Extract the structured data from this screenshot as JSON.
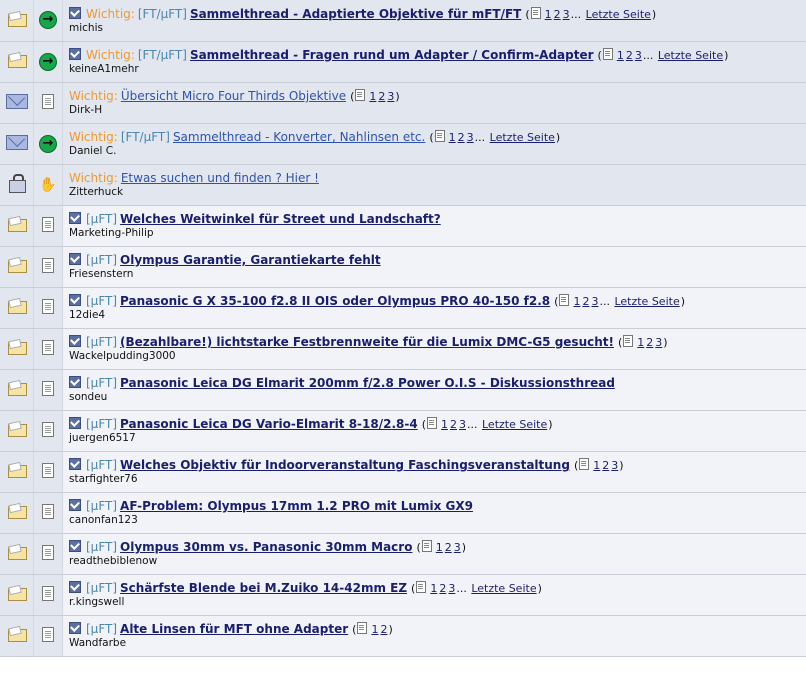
{
  "labels": {
    "wichtig": "Wichtig:",
    "last_page": "Letzte Seite",
    "ellipsis": "..."
  },
  "colors": {
    "wichtig": "#f0992e",
    "prefix": "#4b86ae",
    "link": "#1a1e6e",
    "row_sticky": "#e2e6ef",
    "row_normal": "#f1f3f8"
  },
  "threads": [
    {
      "status_icon": "folder-hot-icon",
      "topic_icon": "green-arrow-icon",
      "checked": true,
      "wichtig": true,
      "prefix": "[FT/µFT]",
      "title": "Sammelthread - Adaptierte Objektive für mFT/FT",
      "bold": true,
      "pages": [
        "1",
        "2",
        "3"
      ],
      "last_page": true,
      "author": "michis"
    },
    {
      "status_icon": "folder-hot-icon",
      "topic_icon": "green-arrow-icon",
      "checked": true,
      "wichtig": true,
      "prefix": "[FT/µFT]",
      "title": "Sammelthread - Fragen rund um Adapter / Confirm-Adapter",
      "bold": true,
      "pages": [
        "1",
        "2",
        "3"
      ],
      "last_page": true,
      "author": "keineA1mehr"
    },
    {
      "status_icon": "mail-icon",
      "topic_icon": "document-icon",
      "checked": false,
      "wichtig": true,
      "prefix": "",
      "title": "Übersicht Micro Four Thirds Objektive",
      "bold": false,
      "pages": [
        "1",
        "2",
        "3"
      ],
      "last_page": false,
      "author": "Dirk-H"
    },
    {
      "status_icon": "mail-icon",
      "topic_icon": "green-arrow-icon",
      "checked": false,
      "wichtig": true,
      "prefix": "[FT/µFT]",
      "title": "Sammelthread - Konverter, Nahlinsen etc.",
      "bold": false,
      "pages": [
        "1",
        "2",
        "3"
      ],
      "last_page": true,
      "author": "Daniel C."
    },
    {
      "status_icon": "lock-icon",
      "topic_icon": "thumbs-up-icon",
      "checked": false,
      "wichtig": true,
      "prefix": "",
      "title": "Etwas suchen und finden ? Hier !",
      "bold": false,
      "pages": [],
      "last_page": false,
      "author": "Zitterhuck"
    },
    {
      "status_icon": "folder-hot-icon",
      "topic_icon": "document-icon",
      "checked": true,
      "wichtig": false,
      "prefix": "[µFT]",
      "title": "Welches Weitwinkel für Street und Landschaft?",
      "bold": true,
      "pages": [],
      "last_page": false,
      "author": "Marketing-Philip"
    },
    {
      "status_icon": "folder-hot-icon",
      "topic_icon": "document-icon",
      "checked": true,
      "wichtig": false,
      "prefix": "[µFT]",
      "title": "Olympus Garantie, Garantiekarte fehlt",
      "bold": true,
      "pages": [],
      "last_page": false,
      "author": "Friesenstern"
    },
    {
      "status_icon": "folder-hot-icon",
      "topic_icon": "document-icon",
      "checked": true,
      "wichtig": false,
      "prefix": "[µFT]",
      "title": "Panasonic G X 35-100 f2.8 II OIS oder Olympus PRO 40-150 f2.8",
      "bold": true,
      "pages": [
        "1",
        "2",
        "3"
      ],
      "last_page": true,
      "author": "12die4"
    },
    {
      "status_icon": "folder-hot-icon",
      "topic_icon": "document-icon",
      "checked": true,
      "wichtig": false,
      "prefix": "[µFT]",
      "title": "(Bezahlbare!) lichtstarke Festbrennweite für die Lumix DMC-G5 gesucht!",
      "bold": true,
      "pages": [
        "1",
        "2",
        "3"
      ],
      "last_page": false,
      "author": "Wackelpudding3000"
    },
    {
      "status_icon": "folder-hot-icon",
      "topic_icon": "document-icon",
      "checked": true,
      "wichtig": false,
      "prefix": "[µFT]",
      "title": "Panasonic Leica DG Elmarit 200mm f/2.8 Power O.I.S - Diskussionsthread",
      "bold": true,
      "pages": [],
      "last_page": false,
      "author": "sondeu"
    },
    {
      "status_icon": "folder-hot-icon",
      "topic_icon": "document-icon",
      "checked": true,
      "wichtig": false,
      "prefix": "[µFT]",
      "title": "Panasonic Leica DG Vario-Elmarit 8-18/2.8-4",
      "bold": true,
      "pages": [
        "1",
        "2",
        "3"
      ],
      "last_page": true,
      "author": "juergen6517"
    },
    {
      "status_icon": "folder-hot-icon",
      "topic_icon": "document-icon",
      "checked": true,
      "wichtig": false,
      "prefix": "[µFT]",
      "title": "Welches Objektiv für Indoorveranstaltung Faschingsveranstaltung",
      "bold": true,
      "pages": [
        "1",
        "2",
        "3"
      ],
      "last_page": false,
      "author": "starfighter76"
    },
    {
      "status_icon": "folder-hot-icon",
      "topic_icon": "document-icon",
      "checked": true,
      "wichtig": false,
      "prefix": "[µFT]",
      "title": "AF-Problem: Olympus 17mm 1.2 PRO mit Lumix GX9",
      "bold": true,
      "pages": [],
      "last_page": false,
      "author": "canonfan123"
    },
    {
      "status_icon": "folder-hot-icon",
      "topic_icon": "document-icon",
      "checked": true,
      "wichtig": false,
      "prefix": "[µFT]",
      "title": "Olympus 30mm vs. Panasonic 30mm Macro",
      "bold": true,
      "pages": [
        "1",
        "2",
        "3"
      ],
      "last_page": false,
      "author": "readthebiblenow"
    },
    {
      "status_icon": "folder-hot-icon",
      "topic_icon": "document-icon",
      "checked": true,
      "wichtig": false,
      "prefix": "[µFT]",
      "title": "Schärfste Blende bei M.Zuiko 14-42mm EZ",
      "bold": true,
      "pages": [
        "1",
        "2",
        "3"
      ],
      "last_page": true,
      "author": "r.kingswell"
    },
    {
      "status_icon": "folder-hot-icon",
      "topic_icon": "document-icon",
      "checked": true,
      "wichtig": false,
      "prefix": "[µFT]",
      "title": "Alte Linsen für MFT ohne Adapter",
      "bold": true,
      "pages": [
        "1",
        "2"
      ],
      "last_page": false,
      "author": "Wandfarbe"
    }
  ]
}
